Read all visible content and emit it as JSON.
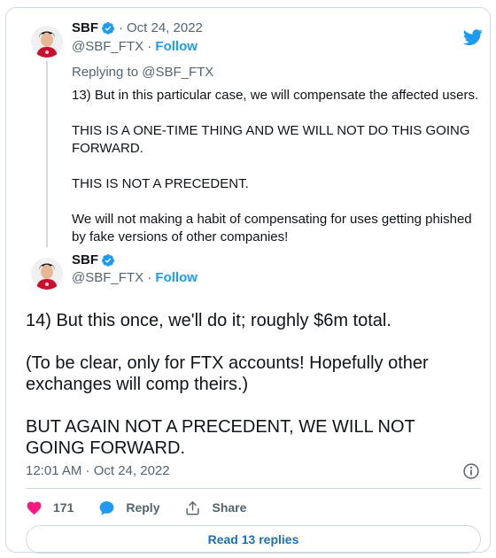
{
  "colors": {
    "accent": "#1d9bf0",
    "text_primary": "#0f1419",
    "text_secondary": "#536471",
    "border": "#cfd9de",
    "like": "#f91880"
  },
  "icons": {
    "logo": "twitter-bird-icon",
    "verified": "verified-badge-icon",
    "info": "info-icon",
    "like": "heart-icon",
    "reply": "speech-bubble-icon",
    "share": "share-icon"
  },
  "parent_tweet": {
    "name": "SBF",
    "date": "Oct 24, 2022",
    "handle": "@SBF_FTX",
    "follow": "Follow",
    "replying_to": "Replying to @SBF_FTX",
    "paragraphs": [
      "13) But in this particular case, we will compensate the affected users.",
      "THIS IS A ONE-TIME THING AND WE WILL NOT DO THIS GOING FORWARD.",
      "THIS IS NOT A PRECEDENT.",
      "We will not making a habit of compensating for uses getting phished by fake versions of other companies!"
    ]
  },
  "main_tweet": {
    "name": "SBF",
    "handle": "@SBF_FTX",
    "follow": "Follow",
    "paragraphs": [
      "14) But this once, we'll do it; roughly $6m total.",
      "(To be clear, only for FTX accounts!  Hopefully other exchanges will comp theirs.)",
      "BUT AGAIN NOT A PRECEDENT, WE WILL NOT GOING FORWARD."
    ],
    "timestamp": "12:01 AM · Oct 24, 2022",
    "likes": "171",
    "reply_label": "Reply",
    "share_label": "Share",
    "read_replies": "Read 13 replies"
  },
  "separator": "·"
}
